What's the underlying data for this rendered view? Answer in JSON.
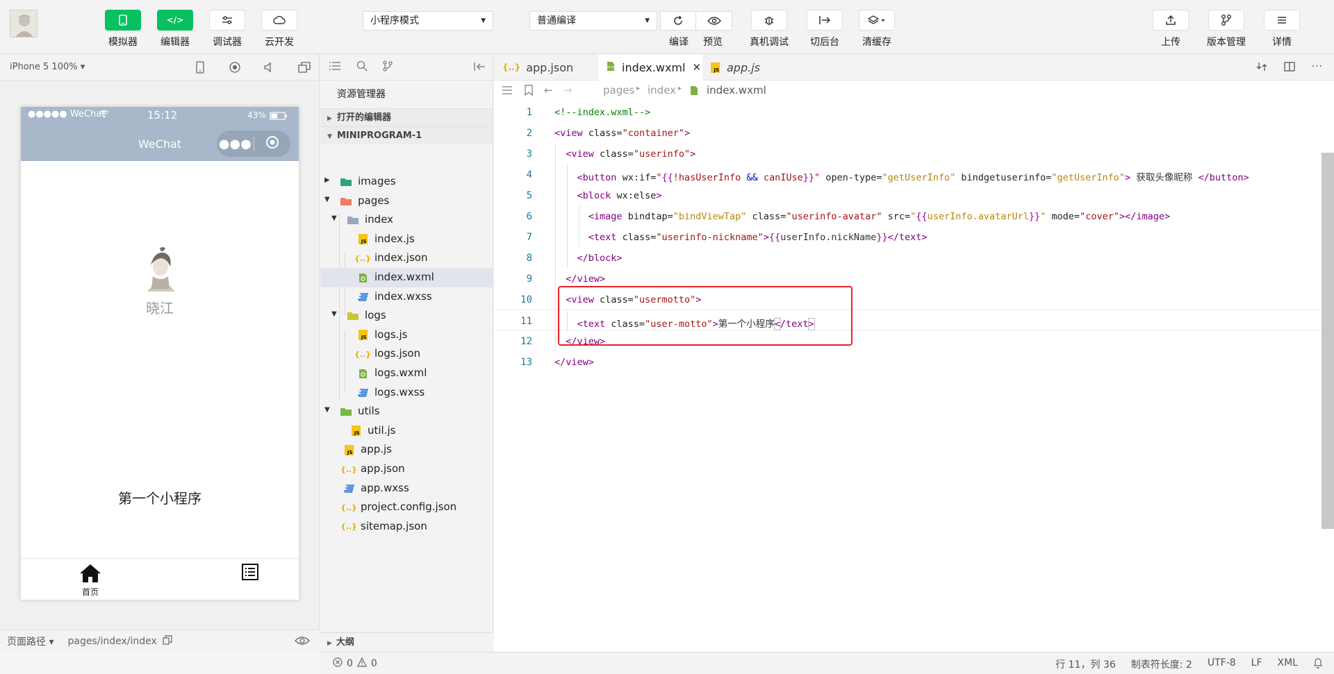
{
  "toolbar": {
    "simulator": "模拟器",
    "editor": "编辑器",
    "debugger": "调试器",
    "cloud": "云开发",
    "mode_select": "小程序模式",
    "compile_select": "普通编译",
    "compile": "编译",
    "preview": "预览",
    "device_debug": "真机调试",
    "background": "切后台",
    "clear_cache": "清缓存",
    "upload": "上传",
    "version": "版本管理",
    "details": "详情"
  },
  "simulator": {
    "device": "iPhone 5 100% ▾",
    "status_left": "●●●●● WeChat",
    "status_time": "15:12",
    "status_battery": "43%",
    "nav_title": "WeChat",
    "nickname": "晓江",
    "motto": "第一个小程序",
    "tab_home": "首页",
    "footer_path_label": "页面路径 ▾",
    "footer_path": "pages/index/index"
  },
  "explorer": {
    "title": "资源管理器",
    "open_editors": "打开的编辑器",
    "project": "MINIPROGRAM-1",
    "outline": "大纲",
    "items": [
      {
        "label": "images",
        "type": "folder-img"
      },
      {
        "label": "pages",
        "type": "folder-red"
      },
      {
        "label": "index",
        "type": "folder"
      },
      {
        "label": "index.js",
        "type": "js"
      },
      {
        "label": "index.json",
        "type": "json"
      },
      {
        "label": "index.wxml",
        "type": "wxml"
      },
      {
        "label": "index.wxss",
        "type": "css"
      },
      {
        "label": "logs",
        "type": "folder-logs"
      },
      {
        "label": "logs.js",
        "type": "js"
      },
      {
        "label": "logs.json",
        "type": "json"
      },
      {
        "label": "logs.wxml",
        "type": "wxml"
      },
      {
        "label": "logs.wxss",
        "type": "css"
      },
      {
        "label": "utils",
        "type": "folder-utils"
      },
      {
        "label": "util.js",
        "type": "js"
      },
      {
        "label": "app.js",
        "type": "js"
      },
      {
        "label": "app.json",
        "type": "json"
      },
      {
        "label": "app.wxss",
        "type": "css"
      },
      {
        "label": "project.config.json",
        "type": "json"
      },
      {
        "label": "sitemap.json",
        "type": "json"
      }
    ]
  },
  "editor": {
    "tabs": [
      "app.json",
      "index.wxml",
      "app.js"
    ],
    "breadcrumbs": [
      "pages",
      "index",
      "index.wxml"
    ],
    "line_numbers": [
      "1",
      "2",
      "3",
      "4",
      "5",
      "6",
      "7",
      "8",
      "9",
      "10",
      "11",
      "12",
      "13"
    ]
  },
  "statusbar": {
    "errors": "0",
    "warnings": "0",
    "position": "行 11，列 36",
    "tab_size": "制表符长度: 2",
    "encoding": "UTF-8",
    "eol": "LF",
    "language": "XML"
  },
  "colors": {
    "accent_green": "#07c160",
    "phone_nav": "#a8b8ca",
    "highlight_red": "#e8202a"
  }
}
